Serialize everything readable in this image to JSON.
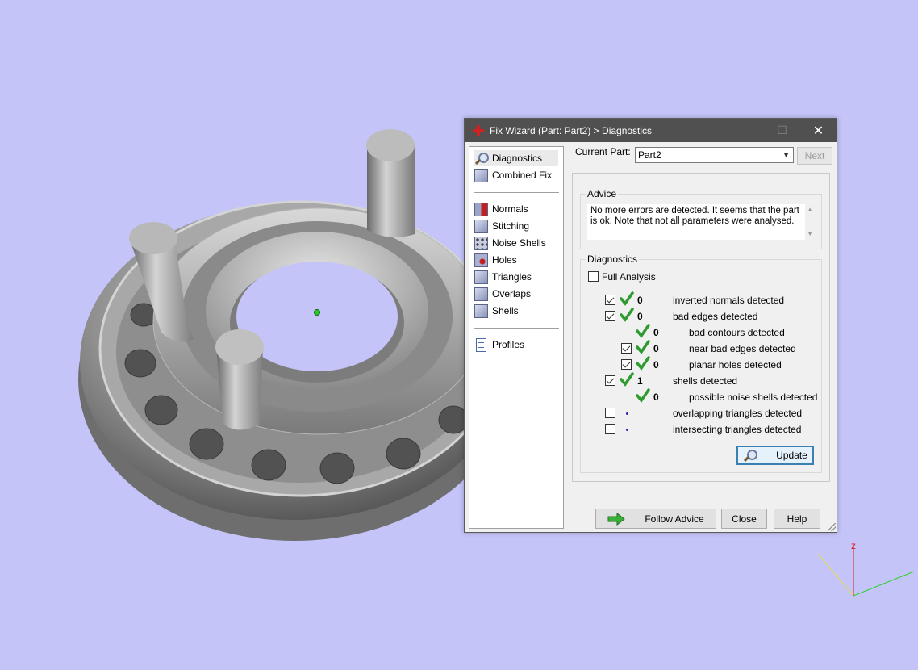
{
  "window": {
    "title": "Fix Wizard (Part: Part2) > Diagnostics",
    "minimize": "—",
    "maximize": "☐",
    "close": "✕"
  },
  "nav": {
    "top": [
      {
        "label": "Diagnostics",
        "icon": "magnifier-icon",
        "selected": true
      },
      {
        "label": "Combined Fix",
        "icon": "cube-icon"
      }
    ],
    "fixes": [
      {
        "label": "Normals",
        "icon": "normals-cube-icon"
      },
      {
        "label": "Stitching",
        "icon": "stitching-cube-icon"
      },
      {
        "label": "Noise Shells",
        "icon": "noise-shells-cube-icon"
      },
      {
        "label": "Holes",
        "icon": "holes-cube-icon"
      },
      {
        "label": "Triangles",
        "icon": "triangles-cube-icon"
      },
      {
        "label": "Overlaps",
        "icon": "overlaps-cube-icon"
      },
      {
        "label": "Shells",
        "icon": "shells-cube-icon"
      }
    ],
    "bottom": [
      {
        "label": "Profiles",
        "icon": "document-icon"
      }
    ]
  },
  "current_part": {
    "label": "Current Part:",
    "value": "Part2",
    "next_label": "Next"
  },
  "advice": {
    "title": "Advice",
    "text_line1": "No more errors are detected. It seems that the part",
    "text_line2": "is ok. Note that not all parameters were analysed."
  },
  "diagnostics": {
    "title": "Diagnostics",
    "full_analysis_label": "Full Analysis",
    "rows": [
      {
        "checked": true,
        "status": "ok",
        "count": "0",
        "text": "inverted normals detected"
      },
      {
        "checked": true,
        "status": "ok",
        "count": "0",
        "text": "bad edges detected"
      },
      {
        "checkbox": false,
        "status": "ok",
        "count": "0",
        "text": "bad contours detected"
      },
      {
        "checked": true,
        "status": "ok",
        "count": "0",
        "text": "near bad edges detected"
      },
      {
        "checked": true,
        "status": "ok",
        "count": "0",
        "text": "planar holes detected"
      },
      {
        "checked": true,
        "status": "ok",
        "count": "1",
        "text": "shells detected"
      },
      {
        "checkbox": false,
        "status": "ok",
        "count": "0",
        "text": "possible noise shells detected"
      },
      {
        "checked": false,
        "status": "pending",
        "count": "",
        "text": "overlapping triangles detected"
      },
      {
        "checked": false,
        "status": "pending",
        "count": "",
        "text": "intersecting triangles detected"
      }
    ],
    "update_label": "Update"
  },
  "footer": {
    "follow_advice_label": "Follow Advice",
    "close_label": "Close",
    "help_label": "Help"
  },
  "axes": {
    "z_label": "z"
  },
  "colors": {
    "background": "#c4c4f8",
    "titlebar": "#505050",
    "check_green": "#2e9b2e",
    "axis_x": "#e8e040",
    "axis_y": "#30d030",
    "axis_z": "#e02020"
  }
}
